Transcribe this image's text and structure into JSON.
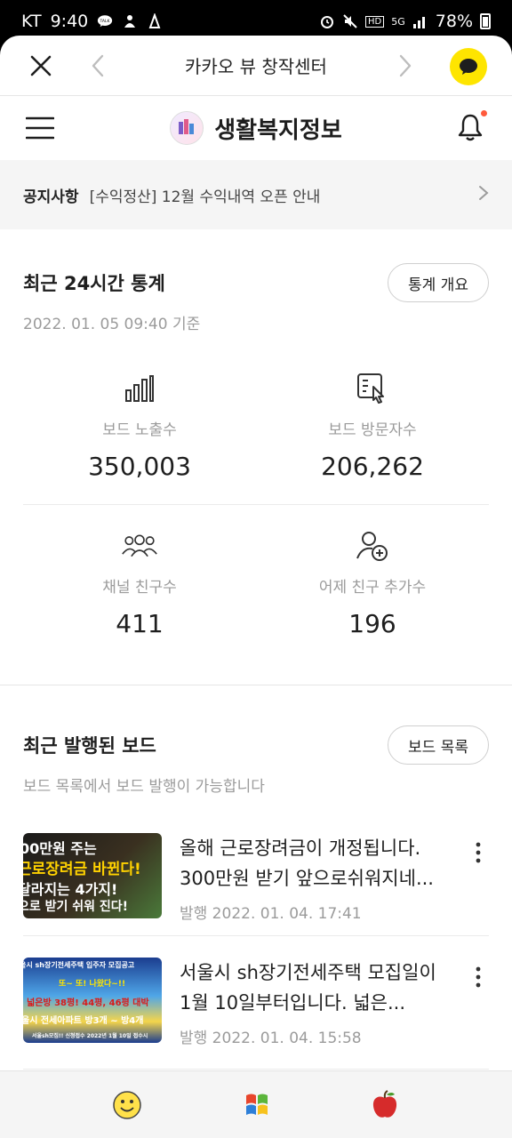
{
  "status_bar": {
    "carrier": "KT",
    "time": "9:40",
    "talk_badge": "TALK",
    "network": "5G",
    "hd_badge": "HD",
    "battery": "78%"
  },
  "topbar": {
    "title": "카카오 뷰 창작센터"
  },
  "channel": {
    "name": "생활복지정보"
  },
  "notice": {
    "label": "공지사항",
    "text": "[수익정산] 12월 수익내역 오픈 안내"
  },
  "stats": {
    "title": "최근 24시간 통계",
    "button": "통계 개요",
    "timestamp": "2022. 01. 05 09:40 기준",
    "items": [
      {
        "label": "보드 노출수",
        "value": "350,003",
        "icon": "bar-chart-icon"
      },
      {
        "label": "보드 방문자수",
        "value": "206,262",
        "icon": "board-visit-icon"
      },
      {
        "label": "채널 친구수",
        "value": "411",
        "icon": "group-icon"
      },
      {
        "label": "어제 친구 추가수",
        "value": "196",
        "icon": "add-friend-icon"
      }
    ]
  },
  "boards": {
    "title": "최근 발행된 보드",
    "button": "보드 목록",
    "subtitle": "보드 목록에서 보드 발행이 가능합니다",
    "items": [
      {
        "title": "올해 근로장려금이 개정됩니다. 300만원 받기 앞으로쉬워지네...",
        "meta": "발행 2022. 01. 04. 17:41",
        "thumb_lines": [
          "00만원 주는",
          "근로장려금 바뀐다!",
          "달라지는 4가지!",
          "으로 받기 쉬워 진다!"
        ]
      },
      {
        "title": "서울시 sh장기전세주택 모집일이 1월 10일부터입니다. 넓은...",
        "meta": "발행 2022. 01. 04. 15:58",
        "thumb_lines": [
          "울시 sh장기전세주택 입주자 모집공고",
          "또~ 또! 나왔다~!!",
          "넓은방 38평! 44평, 46평 대박",
          "울시 전세아파트 방3개 ~ 방4개",
          "서울sh모집!! 신청접수 2022년 1월 10일 접수시"
        ]
      }
    ]
  },
  "colors": {
    "kakao_yellow": "#fee500",
    "notification_dot": "#ff5a3c",
    "muted_text": "#9b9b9b"
  }
}
